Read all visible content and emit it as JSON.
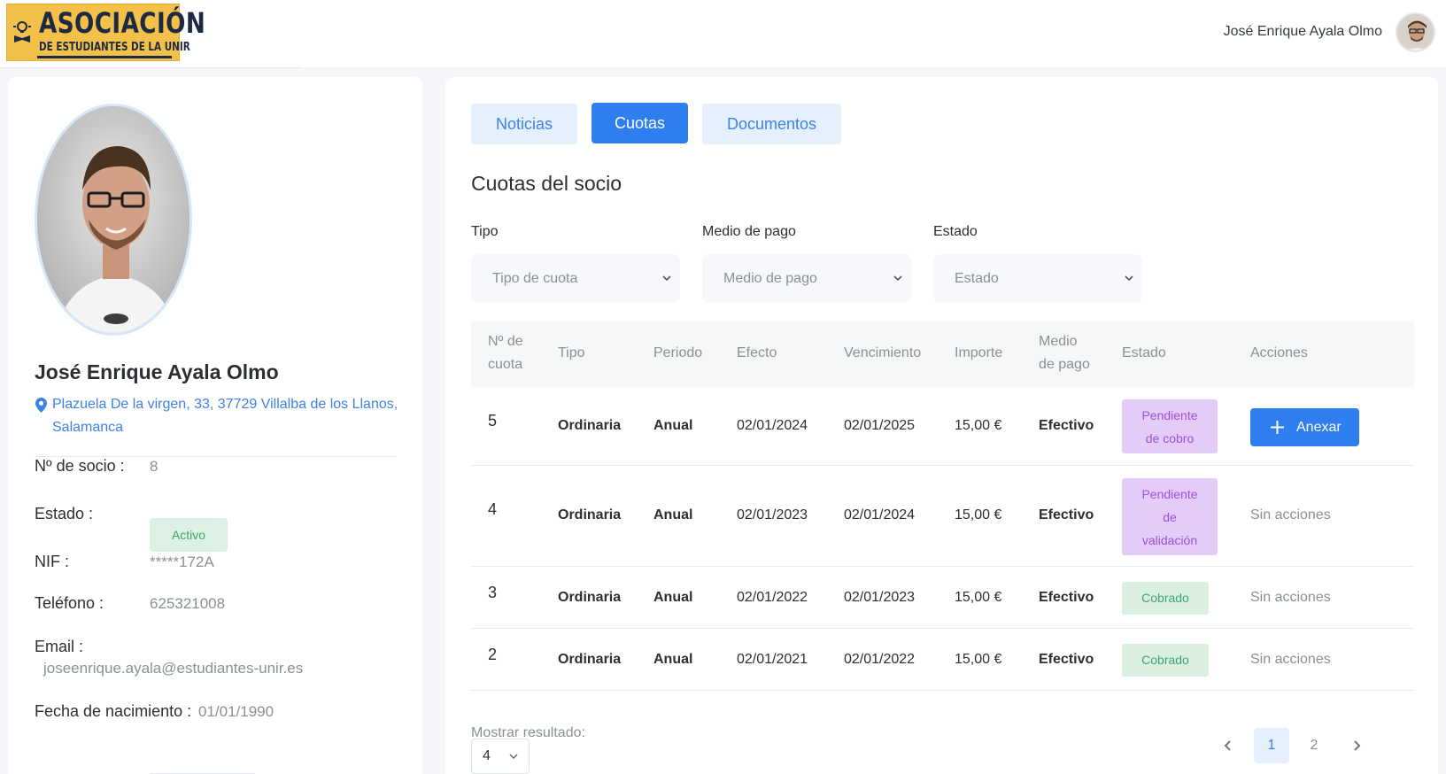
{
  "header": {
    "logo_title": "ASOCIACIÓN",
    "logo_subtitle": "DE ESTUDIANTES DE LA UNIR",
    "user_name": "José Enrique Ayala Olmo"
  },
  "profile": {
    "name": "José Enrique Ayala Olmo",
    "address": "Plazuela De la virgen, 33, 37729 Villalba de los Llanos, Salamanca",
    "fields": {
      "member_no_label": "Nº de socio :",
      "member_no_value": "8",
      "status_label": "Estado :",
      "status_value": "Activo",
      "nif_label": "NIF :",
      "nif_value": "*****172A",
      "phone_label": "Teléfono :",
      "phone_value": "625321008",
      "email_label": "Email :",
      "email_value": "joseenrique.ayala@estudiantes-unir.es",
      "birth_label": "Fecha de nacimiento :",
      "birth_value": "01/01/1990"
    }
  },
  "tabs": [
    {
      "label": "Noticias",
      "active": false
    },
    {
      "label": "Cuotas",
      "active": true
    },
    {
      "label": "Documentos",
      "active": false
    }
  ],
  "section_title": "Cuotas del socio",
  "filters": [
    {
      "label": "Tipo",
      "placeholder": "Tipo de cuota"
    },
    {
      "label": "Medio de pago",
      "placeholder": "Medio de pago"
    },
    {
      "label": "Estado",
      "placeholder": "Estado"
    }
  ],
  "table": {
    "headers": {
      "number_line1": "Nº de",
      "number_line2": "cuota",
      "type": "Tipo",
      "period": "Periodo",
      "effect": "Efecto",
      "due": "Vencimiento",
      "amount": "Importe",
      "payment_line1": "Medio",
      "payment_line2": "de pago",
      "status": "Estado",
      "actions": "Acciones"
    },
    "rows": [
      {
        "number": "5",
        "type": "Ordinaria",
        "period": "Anual",
        "effect": "02/01/2024",
        "due": "02/01/2025",
        "amount": "15,00 €",
        "payment": "Efectivo",
        "status_line1": "Pendiente",
        "status_line2": "de cobro",
        "action": "Anexar"
      },
      {
        "number": "4",
        "type": "Ordinaria",
        "period": "Anual",
        "effect": "02/01/2023",
        "due": "02/01/2024",
        "amount": "15,00 €",
        "payment": "Efectivo",
        "status_line1": "Pendiente",
        "status_line2": "de",
        "status_line3": "validación",
        "action": "Sin acciones"
      },
      {
        "number": "3",
        "type": "Ordinaria",
        "period": "Anual",
        "effect": "02/01/2022",
        "due": "02/01/2023",
        "amount": "15,00 €",
        "payment": "Efectivo",
        "status": "Cobrado",
        "action": "Sin acciones"
      },
      {
        "number": "2",
        "type": "Ordinaria",
        "period": "Anual",
        "effect": "02/01/2021",
        "due": "02/01/2022",
        "amount": "15,00 €",
        "payment": "Efectivo",
        "status": "Cobrado",
        "action": "Sin acciones"
      }
    ]
  },
  "footer": {
    "show_label": "Mostrar resultado:",
    "page_size": "4",
    "pages": [
      "1",
      "2"
    ],
    "current_page": "1"
  },
  "colors": {
    "primary": "#2f7ef0",
    "primary_light": "#e5f0fd",
    "pending": "#e3ccf7",
    "paid": "#dcf0e2",
    "logo_bg": "#f3c14a"
  }
}
